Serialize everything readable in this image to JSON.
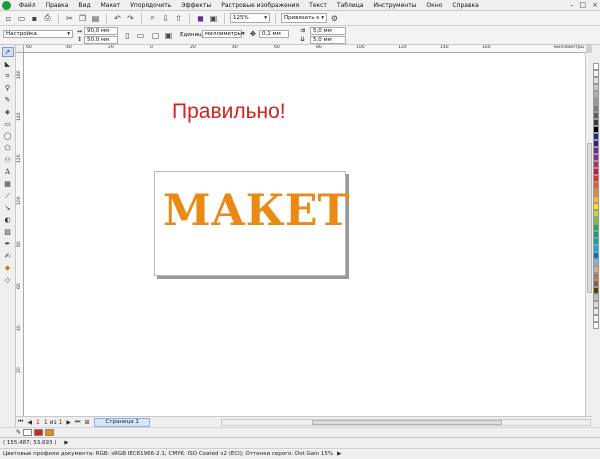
{
  "menu": {
    "items": [
      "Файл",
      "Правка",
      "Вид",
      "Макет",
      "Упорядочить",
      "Эффекты",
      "Растровые изображения",
      "Текст",
      "Таблица",
      "Инструменты",
      "Окно",
      "Справка"
    ],
    "window_controls": [
      "–",
      "□",
      "×"
    ]
  },
  "toolbar": {
    "zoom": "125%",
    "snap_to": "Привязать к"
  },
  "property_bar": {
    "preset": "Настройка",
    "width": "90,0 мм",
    "height": "50,0 мм",
    "units_label": "Единицы:",
    "units_value": "миллиметры",
    "nudge": "0,1 мм",
    "dup_x": "5,0 мм",
    "dup_y": "5,0 мм"
  },
  "ruler": {
    "top_labels": [
      "60",
      "40",
      "20",
      "0",
      "20",
      "40",
      "60",
      "80",
      "100",
      "120",
      "140",
      "160"
    ],
    "left_labels": [
      "160",
      "140",
      "120",
      "100",
      "80",
      "60",
      "40",
      "20"
    ],
    "unit": "миллиметры"
  },
  "canvas": {
    "heading": "Правильно!",
    "mockup_word": "МАКЕТ",
    "heading_color": "#d62020",
    "mockup_color": "#ea8a14"
  },
  "page_nav": {
    "page_num": "1",
    "page_count": "1 из 1",
    "page_tab": "Страница 1"
  },
  "palette": {
    "colors": [
      "#ffffff",
      "#f2f2f2",
      "#e0e0e0",
      "#c8c8c8",
      "#b0b0b0",
      "#969696",
      "#7a7a7a",
      "#5c5c5c",
      "#3c3c3c",
      "#000000",
      "#1d2a86",
      "#3b1f87",
      "#6b2c91",
      "#8c2a8c",
      "#c21f7a",
      "#d2143c",
      "#e62e26",
      "#ef5a24",
      "#f58220",
      "#fbb040",
      "#fde600",
      "#c2d82e",
      "#7ac143",
      "#2aa84a",
      "#00a67e",
      "#00a99d",
      "#00aeef",
      "#0072bc",
      "#8fb0d6",
      "#c6b58c",
      "#a67c52",
      "#8c6239",
      "#603813",
      "#bfbfbf",
      "#d9d9d9",
      "#eaeaea",
      "#f5f5f5",
      "#ffffff"
    ]
  },
  "status": {
    "coords": "( 155,487; 53,693 )",
    "profiles": "Цветовые профили документа: RGB: sRGB IEC61966-2.1; CMYK: ISO Coated v2 (ECI); Оттенки серого: Dot Gain 15%"
  }
}
